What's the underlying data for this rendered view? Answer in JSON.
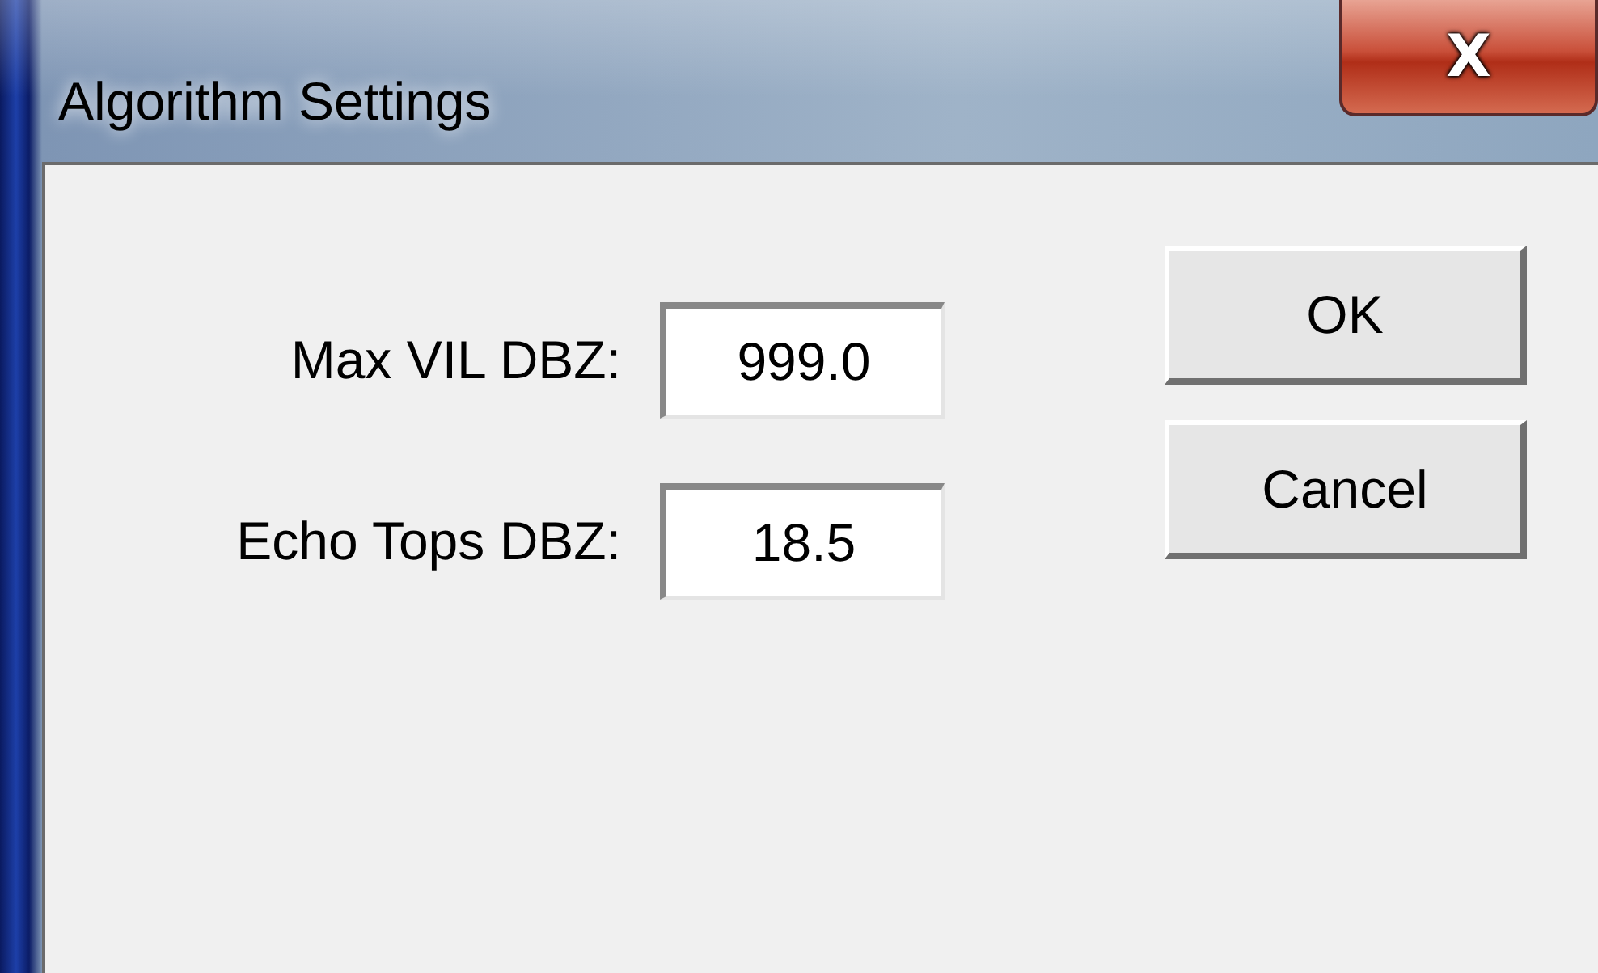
{
  "window": {
    "title": "Algorithm Settings",
    "close": "X"
  },
  "fields": [
    {
      "label": "Max VIL DBZ:",
      "value": "999.0"
    },
    {
      "label": "Echo Tops DBZ:",
      "value": "18.5"
    }
  ],
  "buttons": [
    "OK",
    "Cancel"
  ]
}
